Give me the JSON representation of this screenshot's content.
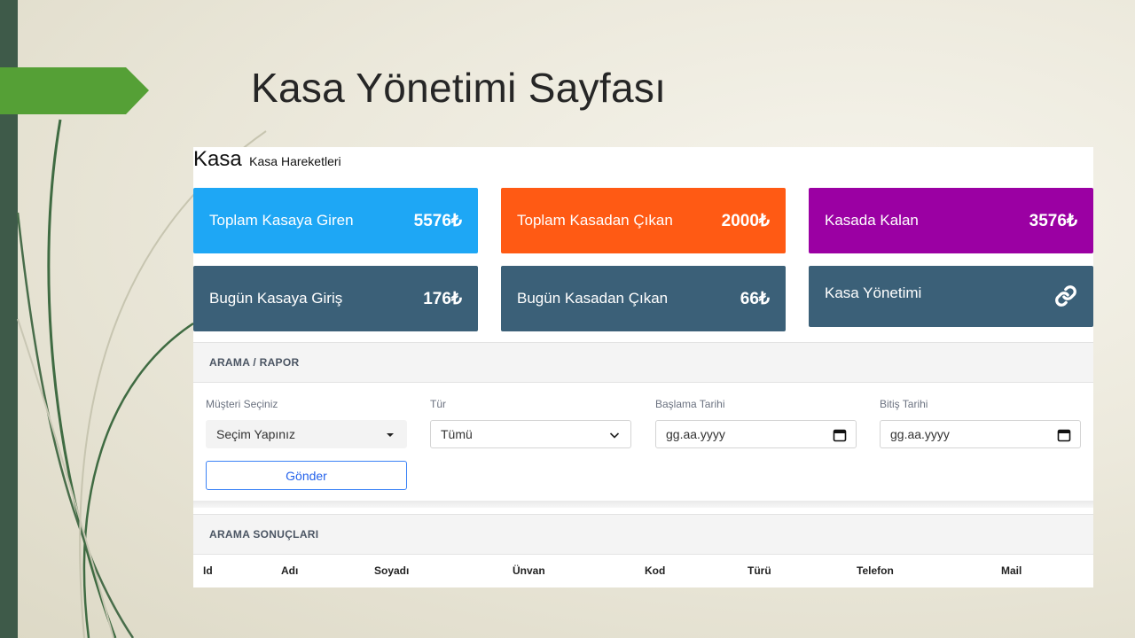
{
  "slide": {
    "title": "Kasa Yönetimi Sayfası"
  },
  "panel": {
    "title": "Kasa",
    "subtitle": "Kasa Hareketleri"
  },
  "cards": [
    {
      "label": "Toplam Kasaya Giren",
      "value": "5576₺",
      "color": "#1ea7f5"
    },
    {
      "label": "Toplam Kasadan Çıkan",
      "value": "2000₺",
      "color": "#ff5a14"
    },
    {
      "label": "Kasada Kalan",
      "value": "3576₺",
      "color": "#9b00a3"
    },
    {
      "label": "Bugün Kasaya Giriş",
      "value": "176₺",
      "color": "#3b6078"
    },
    {
      "label": "Bugün Kasadan Çıkan",
      "value": "66₺",
      "color": "#3b6078"
    },
    {
      "label": "Kasa Yönetimi",
      "icon": "link-icon",
      "color": "#3b6078"
    }
  ],
  "search": {
    "heading": "ARAMA / RAPOR",
    "customer_label": "Müşteri Seçiniz",
    "customer_value": "Seçim Yapınız",
    "type_label": "Tür",
    "type_value": "Tümü",
    "start_label": "Başlama Tarihi",
    "start_placeholder": "gg.aa.yyyy",
    "end_label": "Bitiş Tarihi",
    "end_placeholder": "gg.aa.yyyy",
    "submit_label": "Gönder"
  },
  "results": {
    "heading": "ARAMA SONUÇLARI",
    "columns": [
      "Id",
      "Adı",
      "Soyadı",
      "Ünvan",
      "Kod",
      "Türü",
      "Telefon",
      "Mail"
    ]
  }
}
